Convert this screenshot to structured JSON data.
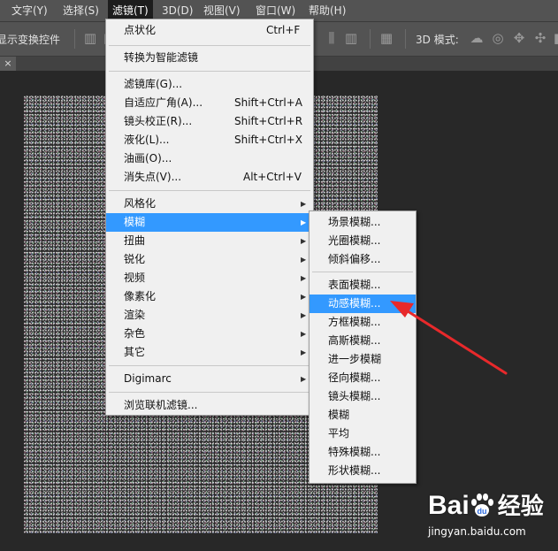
{
  "menubar": {
    "items": [
      "文字(Y)",
      "选择(S)",
      "滤镜(T)",
      "3D(D)",
      "视图(V)",
      "窗口(W)",
      "帮助(H)"
    ],
    "active_index": 2
  },
  "optbar": {
    "show_transform_controls": "显示变换控件",
    "mode_3d": "3D 模式:"
  },
  "tab": {
    "close": "×"
  },
  "filter_menu": {
    "items": [
      {
        "label": "点状化",
        "shortcut": "Ctrl+F"
      },
      {
        "label": "转换为智能滤镜"
      },
      {
        "label": "滤镜库(G)..."
      },
      {
        "label": "自适应广角(A)...",
        "shortcut": "Shift+Ctrl+A"
      },
      {
        "label": "镜头校正(R)...",
        "shortcut": "Shift+Ctrl+R"
      },
      {
        "label": "液化(L)...",
        "shortcut": "Shift+Ctrl+X"
      },
      {
        "label": "油画(O)..."
      },
      {
        "label": "消失点(V)...",
        "shortcut": "Alt+Ctrl+V"
      },
      {
        "label": "风格化",
        "submenu": true
      },
      {
        "label": "模糊",
        "submenu": true,
        "highlighted": true
      },
      {
        "label": "扭曲",
        "submenu": true
      },
      {
        "label": "锐化",
        "submenu": true
      },
      {
        "label": "视频",
        "submenu": true
      },
      {
        "label": "像素化",
        "submenu": true
      },
      {
        "label": "渲染",
        "submenu": true
      },
      {
        "label": "杂色",
        "submenu": true
      },
      {
        "label": "其它",
        "submenu": true
      },
      {
        "label": "Digimarc",
        "submenu": true
      },
      {
        "label": "浏览联机滤镜..."
      }
    ]
  },
  "blur_submenu": {
    "items": [
      {
        "label": "场景模糊..."
      },
      {
        "label": "光圈模糊..."
      },
      {
        "label": "倾斜偏移..."
      },
      {
        "label": "表面模糊..."
      },
      {
        "label": "动感模糊...",
        "highlighted": true
      },
      {
        "label": "方框模糊..."
      },
      {
        "label": "高斯模糊..."
      },
      {
        "label": "进一步模糊"
      },
      {
        "label": "径向模糊..."
      },
      {
        "label": "镜头模糊..."
      },
      {
        "label": "模糊"
      },
      {
        "label": "平均"
      },
      {
        "label": "特殊模糊..."
      },
      {
        "label": "形状模糊..."
      }
    ]
  },
  "watermark": {
    "logo_left": "Bai",
    "logo_right": "经验",
    "url": "jingyan.baidu.com"
  },
  "colors": {
    "highlight": "#3399ff",
    "arrow": "#e8292b",
    "menubar": "#535353",
    "workspace": "#282828"
  }
}
